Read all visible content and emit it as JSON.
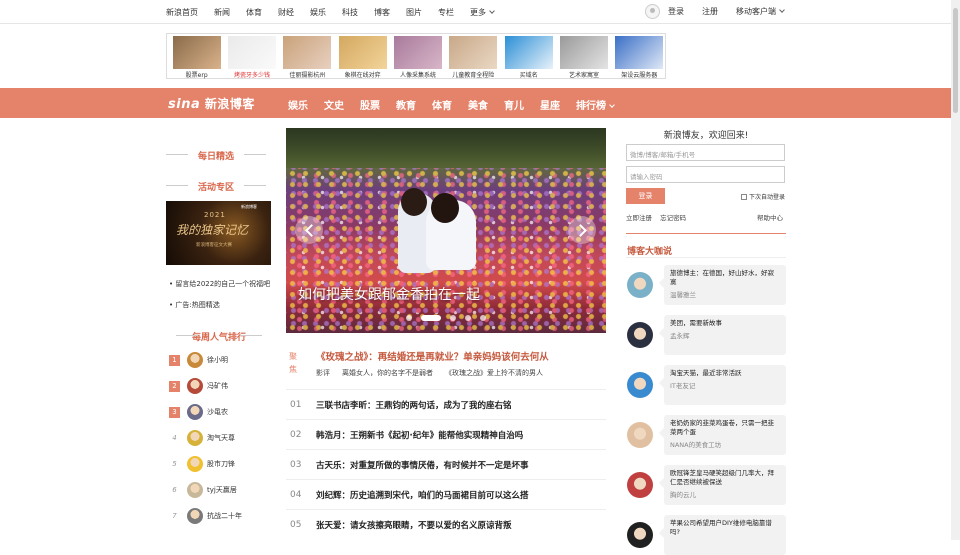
{
  "topnav": {
    "items": [
      "新浪首页",
      "新闻",
      "体育",
      "财经",
      "娱乐",
      "科技",
      "博客",
      "图片",
      "专栏",
      "更多"
    ],
    "login": "登录",
    "register": "注册",
    "mobile": "移动客户端"
  },
  "ads": [
    {
      "label": "股票erp",
      "red": false,
      "colors": [
        "#8a6b4a",
        "#d9b28a"
      ]
    },
    {
      "label": "烤瓷牙多少钱",
      "red": true,
      "colors": [
        "#eaeaea",
        "#fafafa"
      ]
    },
    {
      "label": "佳丽摄影杭州",
      "red": false,
      "colors": [
        "#c9a27a",
        "#e8d0c0"
      ]
    },
    {
      "label": "象棋在线对弈",
      "red": false,
      "colors": [
        "#d4a860",
        "#f2d49a"
      ]
    },
    {
      "label": "人像采集系统",
      "red": false,
      "colors": [
        "#a87a9c",
        "#d8b6c8"
      ]
    },
    {
      "label": "儿童教育全程险",
      "red": false,
      "colors": [
        "#c8a888",
        "#ead8c4"
      ]
    },
    {
      "label": "买域名",
      "red": false,
      "colors": [
        "#2b8fd6",
        "#e8f2fa"
      ]
    },
    {
      "label": "艺术家寓室",
      "red": false,
      "colors": [
        "#9a9a9a",
        "#e4e4e4"
      ]
    },
    {
      "label": "架设云服务器",
      "red": false,
      "colors": [
        "#3a6fc6",
        "#dfe8f6"
      ]
    }
  ],
  "brand": {
    "logo": "sina",
    "name": "新浪博客"
  },
  "mainnav": {
    "items": [
      "娱乐",
      "文史",
      "股票",
      "教育",
      "体育",
      "美食",
      "育儿",
      "星座"
    ],
    "more": "排行榜"
  },
  "left": {
    "daily": "每日精选",
    "events": "活动专区",
    "promo": {
      "year": "2021",
      "big": "我的独家记忆",
      "sub": "新浪博客征文大赛",
      "tag": "新浪博客"
    },
    "links": [
      "留言给2022的自己一个祝福吧",
      "广告:热图精选"
    ],
    "ranking_title": "每周人气排行",
    "ranking": [
      {
        "n": "1",
        "name": "徐小明",
        "top": true,
        "color": "#c88a3a"
      },
      {
        "n": "2",
        "name": "冯矿伟",
        "top": true,
        "color": "#b54a3a"
      },
      {
        "n": "3",
        "name": "沙黾农",
        "top": true,
        "color": "#6a6a8a"
      },
      {
        "n": "4",
        "name": "淘气天尊",
        "top": false,
        "color": "#d6b23a"
      },
      {
        "n": "5",
        "name": "股市刀锋",
        "top": false,
        "color": "#f0c030"
      },
      {
        "n": "6",
        "name": "tyj天赢居",
        "top": false,
        "color": "#c8b89a"
      },
      {
        "n": "7",
        "name": "抗战二十年",
        "top": false,
        "color": "#7a7a7a"
      }
    ]
  },
  "carousel": {
    "caption": "如何把美女跟郁金香拍在一起",
    "dots": 5,
    "active": 1
  },
  "feature": {
    "tag": "聚焦",
    "title": "《玫瑰之战》：再结婚还是再就业？单亲妈妈该何去何从",
    "subs": [
      "影评",
      "离婚女人，你的名字不是弱者",
      "《玫瑰之战》爱上拎不清的男人"
    ]
  },
  "list": [
    {
      "n": "01",
      "t": "三联书店李昕：王鼎钧的两句话，成为了我的座右铭"
    },
    {
      "n": "02",
      "t": "韩浩月：王朔新书《起初·纪年》能帮他实现精神自治吗"
    },
    {
      "n": "03",
      "t": "古天乐：对重复所做的事情厌倦，有时候并不一定是坏事"
    },
    {
      "n": "04",
      "t": "刘纪辉：历史追溯到宋代，咱们的马面裙目前可以这么搭"
    },
    {
      "n": "05",
      "t": "张天爱：请女孩擦亮眼睛，不要以爱的名义原谅背叛"
    }
  ],
  "login": {
    "welcome": "新浪博友，欢迎回来!",
    "user_placeholder": "微博/博客/邮箱/手机号",
    "pass_placeholder": "请输入密码",
    "button": "登录",
    "remember": "下次自动登录",
    "register": "立即注册",
    "forgot": "忘记密码",
    "help": "帮助中心"
  },
  "talks": {
    "title": "博客大咖说",
    "items": [
      {
        "q": "旅德博主：在德国，好山好水，好寂寞",
        "au": "温馨雅兰",
        "color": "#7ab0c8"
      },
      {
        "q": "美团，需要新故事",
        "au": "孟永辉",
        "color": "#2a3040"
      },
      {
        "q": "淘宝天猫，最近非常活跃",
        "au": "IT老友记",
        "color": "#3a8ad0"
      },
      {
        "q": "老奶奶家的韭菜鸡蛋卷，只需一把韭菜两个蛋",
        "au": "NANA的美食工坊",
        "color": "#e0c0a0"
      },
      {
        "q": "欧冠锋芝皇马硬笑超级门几率大，拜仁是否继续被保送",
        "au": "胸的云儿",
        "color": "#c04040"
      },
      {
        "q": "苹果公司希望用户DIY维修电脑靠谱吗?",
        "au": "",
        "color": "#202020"
      }
    ]
  }
}
